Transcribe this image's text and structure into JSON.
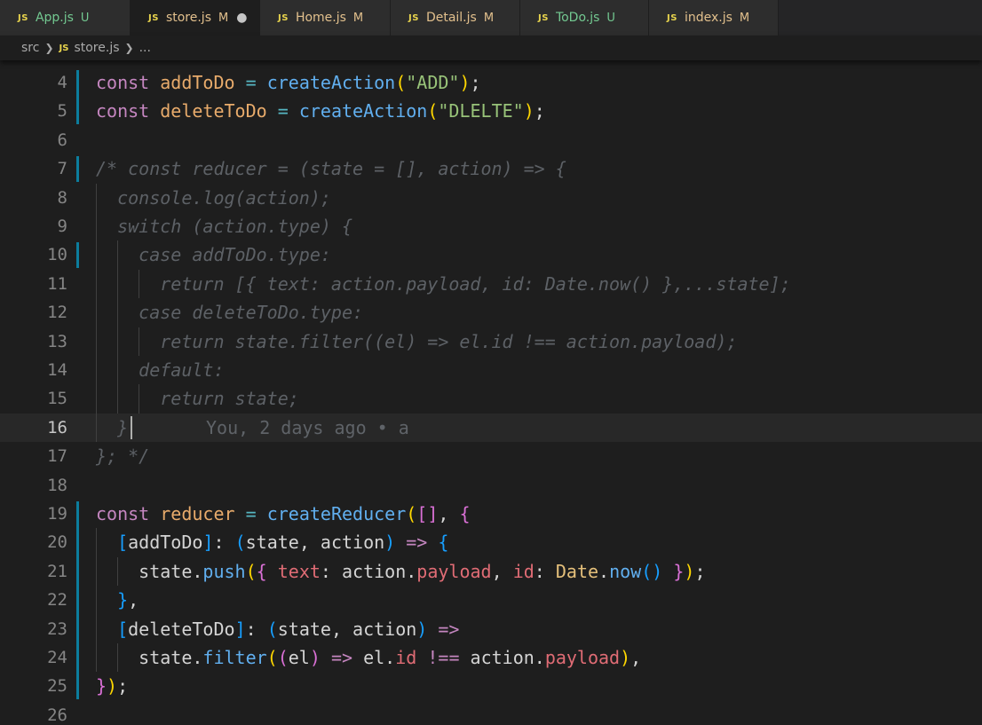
{
  "tabs": [
    {
      "name": "App.js",
      "status": "U",
      "untracked": true,
      "active": false,
      "dirty": false
    },
    {
      "name": "store.js",
      "status": "M",
      "untracked": false,
      "active": true,
      "dirty": true
    },
    {
      "name": "Home.js",
      "status": "M",
      "untracked": false,
      "active": false,
      "dirty": false
    },
    {
      "name": "Detail.js",
      "status": "M",
      "untracked": false,
      "active": false,
      "dirty": false
    },
    {
      "name": "ToDo.js",
      "status": "U",
      "untracked": true,
      "active": false,
      "dirty": false
    },
    {
      "name": "index.js",
      "status": "M",
      "untracked": false,
      "active": false,
      "dirty": false
    }
  ],
  "tab_icon": "JS",
  "dirty_glyph": "●",
  "breadcrumb": {
    "folder": "src",
    "file": "store.js",
    "more": "..."
  },
  "editor": {
    "current_line": 16,
    "blame": "You, 2 days ago • a",
    "lines": [
      {
        "n": 4,
        "tokens": [
          [
            "k",
            "const"
          ],
          [
            "id",
            " "
          ],
          [
            "v",
            "addToDo"
          ],
          [
            "id",
            " "
          ],
          [
            "o",
            "="
          ],
          [
            "id",
            " "
          ],
          [
            "f",
            "createAction"
          ],
          [
            "p1",
            "("
          ],
          [
            "s",
            "\"ADD\""
          ],
          [
            "p1",
            ")"
          ],
          [
            "pn",
            ";"
          ]
        ]
      },
      {
        "n": 5,
        "tokens": [
          [
            "k",
            "const"
          ],
          [
            "id",
            " "
          ],
          [
            "v",
            "deleteToDo"
          ],
          [
            "id",
            " "
          ],
          [
            "o",
            "="
          ],
          [
            "id",
            " "
          ],
          [
            "f",
            "createAction"
          ],
          [
            "p1",
            "("
          ],
          [
            "s",
            "\"DLELTE\""
          ],
          [
            "p1",
            ")"
          ],
          [
            "pn",
            ";"
          ]
        ]
      },
      {
        "n": 6,
        "tokens": []
      },
      {
        "n": 7,
        "tokens": [
          [
            "c",
            "/* const reducer = (state = [], action) => {"
          ]
        ]
      },
      {
        "n": 8,
        "tokens": [
          [
            "c",
            "  console.log(action);"
          ]
        ]
      },
      {
        "n": 9,
        "tokens": [
          [
            "c",
            "  switch (action.type) {"
          ]
        ]
      },
      {
        "n": 10,
        "tokens": [
          [
            "c",
            "    case addToDo.type:"
          ]
        ]
      },
      {
        "n": 11,
        "tokens": [
          [
            "c",
            "      return [{ text: action.payload, id: Date.now() },...state];"
          ]
        ]
      },
      {
        "n": 12,
        "tokens": [
          [
            "c",
            "    case deleteToDo.type:"
          ]
        ]
      },
      {
        "n": 13,
        "tokens": [
          [
            "c",
            "      return state.filter((el) => el.id !== action.payload);"
          ]
        ]
      },
      {
        "n": 14,
        "tokens": [
          [
            "c",
            "    default:"
          ]
        ]
      },
      {
        "n": 15,
        "tokens": [
          [
            "c",
            "      return state;"
          ]
        ]
      },
      {
        "n": 16,
        "tokens": [
          [
            "c",
            "  }"
          ]
        ]
      },
      {
        "n": 17,
        "tokens": [
          [
            "c",
            "}; */"
          ]
        ]
      },
      {
        "n": 18,
        "tokens": []
      },
      {
        "n": 19,
        "tokens": [
          [
            "k",
            "const"
          ],
          [
            "id",
            " "
          ],
          [
            "v",
            "reducer"
          ],
          [
            "id",
            " "
          ],
          [
            "o",
            "="
          ],
          [
            "id",
            " "
          ],
          [
            "f",
            "createReducer"
          ],
          [
            "p1",
            "("
          ],
          [
            "p2",
            "[]"
          ],
          [
            "pn",
            ", "
          ],
          [
            "p2",
            "{"
          ]
        ]
      },
      {
        "n": 20,
        "tokens": [
          [
            "id",
            "  "
          ],
          [
            "p3",
            "["
          ],
          [
            "id",
            "addToDo"
          ],
          [
            "p3",
            "]"
          ],
          [
            "pn",
            ": "
          ],
          [
            "p3",
            "("
          ],
          [
            "id",
            "state, action"
          ],
          [
            "p3",
            ")"
          ],
          [
            "id",
            " "
          ],
          [
            "k",
            "=>"
          ],
          [
            "id",
            " "
          ],
          [
            "p3",
            "{"
          ]
        ]
      },
      {
        "n": 21,
        "tokens": [
          [
            "id",
            "    state."
          ],
          [
            "f",
            "push"
          ],
          [
            "p1",
            "("
          ],
          [
            "p2",
            "{"
          ],
          [
            "id",
            " "
          ],
          [
            "pr",
            "text"
          ],
          [
            "pn",
            ": "
          ],
          [
            "id",
            "action."
          ],
          [
            "pr",
            "payload"
          ],
          [
            "pn",
            ", "
          ],
          [
            "pr",
            "id"
          ],
          [
            "pn",
            ": "
          ],
          [
            "cl",
            "Date"
          ],
          [
            "pn",
            "."
          ],
          [
            "f",
            "now"
          ],
          [
            "p3",
            "()"
          ],
          [
            "id",
            " "
          ],
          [
            "p2",
            "}"
          ],
          [
            "p1",
            ")"
          ],
          [
            "pn",
            ";"
          ]
        ]
      },
      {
        "n": 22,
        "tokens": [
          [
            "id",
            "  "
          ],
          [
            "p3",
            "}"
          ],
          [
            "pn",
            ","
          ]
        ]
      },
      {
        "n": 23,
        "tokens": [
          [
            "id",
            "  "
          ],
          [
            "p3",
            "["
          ],
          [
            "id",
            "deleteToDo"
          ],
          [
            "p3",
            "]"
          ],
          [
            "pn",
            ": "
          ],
          [
            "p3",
            "("
          ],
          [
            "id",
            "state, action"
          ],
          [
            "p3",
            ")"
          ],
          [
            "id",
            " "
          ],
          [
            "k",
            "=>"
          ]
        ]
      },
      {
        "n": 24,
        "tokens": [
          [
            "id",
            "    state."
          ],
          [
            "f",
            "filter"
          ],
          [
            "p1",
            "("
          ],
          [
            "p2",
            "("
          ],
          [
            "id",
            "el"
          ],
          [
            "p2",
            ")"
          ],
          [
            "id",
            " "
          ],
          [
            "k",
            "=>"
          ],
          [
            "id",
            " el."
          ],
          [
            "pr",
            "id"
          ],
          [
            "id",
            " "
          ],
          [
            "k",
            "!=="
          ],
          [
            "id",
            " action."
          ],
          [
            "pr",
            "payload"
          ],
          [
            "p1",
            ")"
          ],
          [
            "pn",
            ","
          ]
        ]
      },
      {
        "n": 25,
        "tokens": [
          [
            "p2",
            "}"
          ],
          [
            "p1",
            ")"
          ],
          [
            "pn",
            ";"
          ]
        ]
      },
      {
        "n": 26,
        "tokens": []
      }
    ]
  },
  "colors": {
    "background": "#1e1e1e",
    "tabbar": "#252526",
    "keyword": "#c586c0",
    "variable": "#e8ab6b",
    "function": "#61afef",
    "string": "#98c379",
    "comment": "#5d6166",
    "git_modified_bar": "#0c7d9d"
  }
}
